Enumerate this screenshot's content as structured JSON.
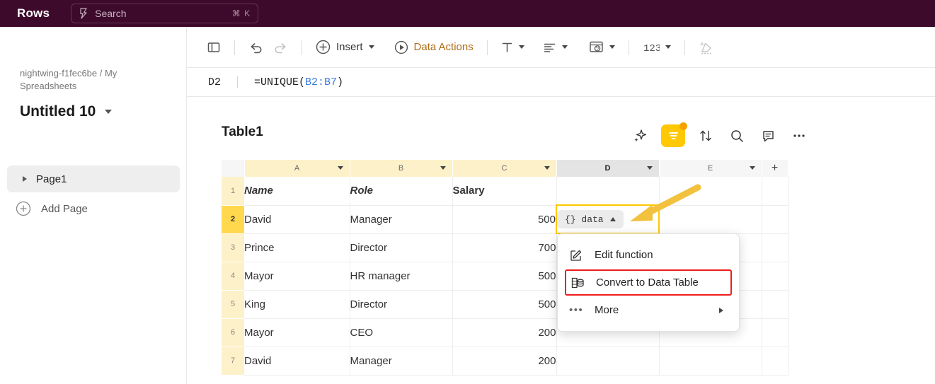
{
  "topbar": {
    "brand": "Rows",
    "search": {
      "icon": "lightning-search-icon",
      "placeholder": "Search",
      "shortcut": "⌘ K"
    }
  },
  "sidebar": {
    "breadcrumb": "nightwing-f1fec6be / My Spreadsheets",
    "doc_title": "Untitled 10",
    "pages": [
      {
        "label": "Page1",
        "selected": true
      }
    ],
    "add_page_label": "Add Page"
  },
  "toolbar": {
    "panel_toggle": "panel-toggle-icon",
    "undo": "undo-icon",
    "redo": "redo-icon",
    "insert_label": "Insert",
    "data_actions_label": "Data Actions",
    "text_format": "text-format-icon",
    "align": "align-icon",
    "fill_color": "fill-color-icon",
    "number_format": "number-format-icon",
    "clear_format": "clear-formatting-icon"
  },
  "formula_bar": {
    "cell_ref": "D2",
    "formula_prefix": "=UNIQUE(",
    "formula_ref": "B2:B7",
    "formula_suffix": ")"
  },
  "table": {
    "title": "Table1",
    "tools": [
      {
        "name": "ai-sparkle-icon",
        "label": "AI"
      },
      {
        "name": "filter-icon",
        "label": "Filter",
        "active": true,
        "badge": true
      },
      {
        "name": "sort-icon",
        "label": "Sort"
      },
      {
        "name": "search-icon",
        "label": "Search"
      },
      {
        "name": "comment-icon",
        "label": "Comment"
      },
      {
        "name": "more-icon",
        "label": "More"
      }
    ],
    "columns": [
      {
        "letter": "A",
        "state": "filtered"
      },
      {
        "letter": "B",
        "state": "filtered"
      },
      {
        "letter": "C",
        "state": "filtered"
      },
      {
        "letter": "D",
        "state": "selected"
      },
      {
        "letter": "E",
        "state": "plain"
      }
    ],
    "add_column_label": "+",
    "rows": [
      {
        "num": "1",
        "active": false,
        "a": "Name",
        "b": "Role",
        "c": "Salary",
        "style": "header"
      },
      {
        "num": "2",
        "active": true,
        "a": "David",
        "b": "Manager",
        "c": "500",
        "style": "data"
      },
      {
        "num": "3",
        "active": false,
        "a": "Prince",
        "b": "Director",
        "c": "700",
        "style": "data"
      },
      {
        "num": "4",
        "active": false,
        "a": "Mayor",
        "b": "HR manager",
        "c": "500",
        "style": "data"
      },
      {
        "num": "5",
        "active": false,
        "a": "King",
        "b": "Director",
        "c": "500",
        "style": "data"
      },
      {
        "num": "6",
        "active": false,
        "a": "Mayor",
        "b": "CEO",
        "c": "200",
        "style": "data"
      },
      {
        "num": "7",
        "active": false,
        "a": "David",
        "b": "Manager",
        "c": "200",
        "style": "data"
      }
    ],
    "selected_cell": {
      "ref": "D2",
      "chip_label": "{} data",
      "chip_caret": "caret-up-icon"
    }
  },
  "context_menu": {
    "items": [
      {
        "label": "Edit function",
        "icon": "edit-pencil-icon",
        "highlighted": false,
        "submenu": false
      },
      {
        "label": "Convert to Data Table",
        "icon": "data-table-icon",
        "highlighted": true,
        "submenu": false
      },
      {
        "label": "More",
        "icon": "more-dots-icon",
        "highlighted": false,
        "submenu": true
      }
    ]
  },
  "annotation": {
    "arrow": "pointer-arrow",
    "color": "#f2c13d"
  },
  "colors": {
    "header_bg": "#3d0a2c",
    "filter_yellow": "#ffc800",
    "selection_yellow": "#ffc800",
    "row_highlight": "#ffd84d",
    "column_filtered": "#fdf1c9",
    "highlight_red": "#f01c1c",
    "accent_orange": "#b06b14",
    "formula_ref_blue": "#3b7ddd"
  }
}
